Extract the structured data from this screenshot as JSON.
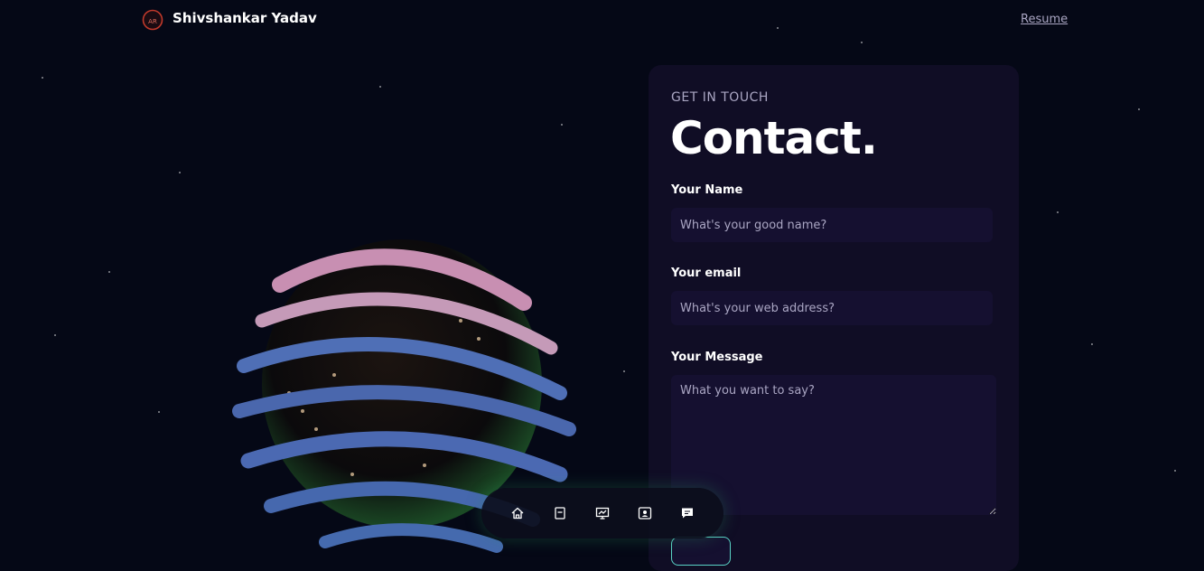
{
  "nav": {
    "brand": "Shivshankar Yadav",
    "logo_text": "AR",
    "resume": "Resume"
  },
  "contact": {
    "eyebrow": "GET IN TOUCH",
    "title": "Contact.",
    "name_label": "Your Name",
    "name_placeholder": "What's your good name?",
    "email_label": "Your email",
    "email_placeholder": "What's your web address?",
    "message_label": "Your Message",
    "message_placeholder": "What you want to say?"
  },
  "dock": {
    "items": [
      "home-icon",
      "bookmark-icon",
      "presentation-icon",
      "contact-card-icon",
      "chat-icon"
    ]
  },
  "colors": {
    "background": "#050816",
    "card": "#100d25",
    "field": "#151030",
    "secondary_text": "#aaa6c3",
    "send_border": "#5ad3c5"
  }
}
